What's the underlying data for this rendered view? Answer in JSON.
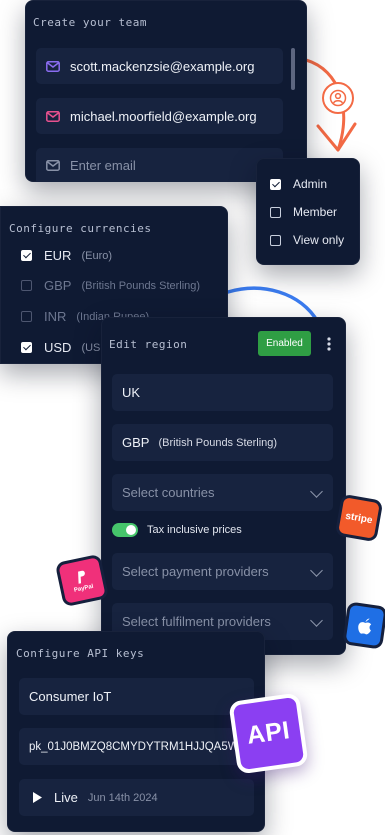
{
  "team": {
    "title": "Create your team",
    "emails": [
      "scott.mackenzsie@example.org",
      "michael.moorfield@example.org"
    ],
    "email_placeholder": "Enter email",
    "roles": [
      {
        "label": "Admin",
        "checked": true
      },
      {
        "label": "Member",
        "checked": false
      },
      {
        "label": "View only",
        "checked": false
      }
    ]
  },
  "currencies": {
    "title": "Configure currencies",
    "items": [
      {
        "code": "EUR",
        "name": "(Euro)",
        "checked": true
      },
      {
        "code": "GBP",
        "name": "(British Pounds Sterling)",
        "checked": false
      },
      {
        "code": "INR",
        "name": "(Indian Rupee)",
        "checked": false
      },
      {
        "code": "USD",
        "name": "(US",
        "checked": true
      }
    ]
  },
  "region": {
    "title": "Edit region",
    "status": "Enabled",
    "name": "UK",
    "currency_code": "GBP",
    "currency_name": "(British Pounds Sterling)",
    "countries_placeholder": "Select countries",
    "tax_label": "Tax inclusive prices",
    "tax_inclusive": true,
    "payment_placeholder": "Select payment providers",
    "fulfilment_placeholder": "Select fulfilment providers"
  },
  "api": {
    "title": "Configure API keys",
    "name": "Consumer IoT",
    "key": "pk_01J0BMZQ8CMYDYTRM1HJJQA5WC",
    "mode": "Live",
    "date": "Jun 14th 2024",
    "badge": "API"
  },
  "logos": {
    "stripe": "stripe",
    "paypal": "PayPal"
  },
  "colors": {
    "panel": "#0f1a33",
    "field": "#17233f",
    "enabled": "#2f9e44",
    "toggle": "#46c56b",
    "connector_orange": "#f36a45",
    "connector_blue": "#3b7cf0",
    "api_purple": "#8b3ff2",
    "stripe": "#f25a2a",
    "paypal": "#f0307a",
    "apple": "#1f6fe5"
  }
}
